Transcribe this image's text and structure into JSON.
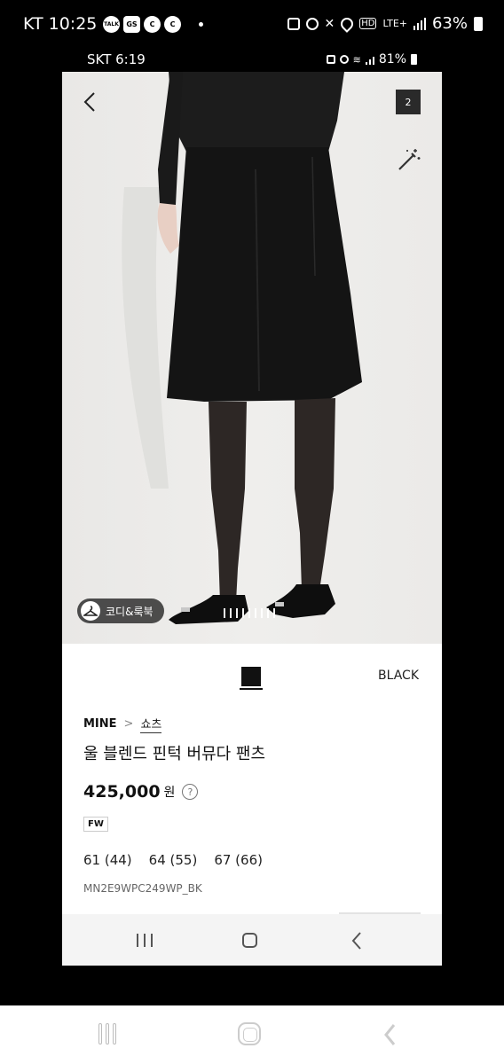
{
  "outer_status": {
    "time": "KT 10:25",
    "badges": [
      "TALK",
      "GS",
      "C",
      "C"
    ],
    "lte": "LTE+",
    "battery": "63%"
  },
  "inner_status": {
    "time": "SKT 6:19",
    "battery": "81%"
  },
  "product_image": {
    "page_count": "2",
    "codi_label": "코디&룩북"
  },
  "product": {
    "color_name": "BLACK",
    "color_hex": "#111111",
    "brand": "MINE",
    "category": "쇼츠",
    "name": "울 블렌드 핀턱 버뮤다 팬츠",
    "price": "425,000",
    "currency": "원",
    "season_badge": "FW",
    "sizes": [
      "61 (44)",
      "64 (55)",
      "67 (66)"
    ],
    "sku": "MN2E9WPC249WP_BK"
  }
}
